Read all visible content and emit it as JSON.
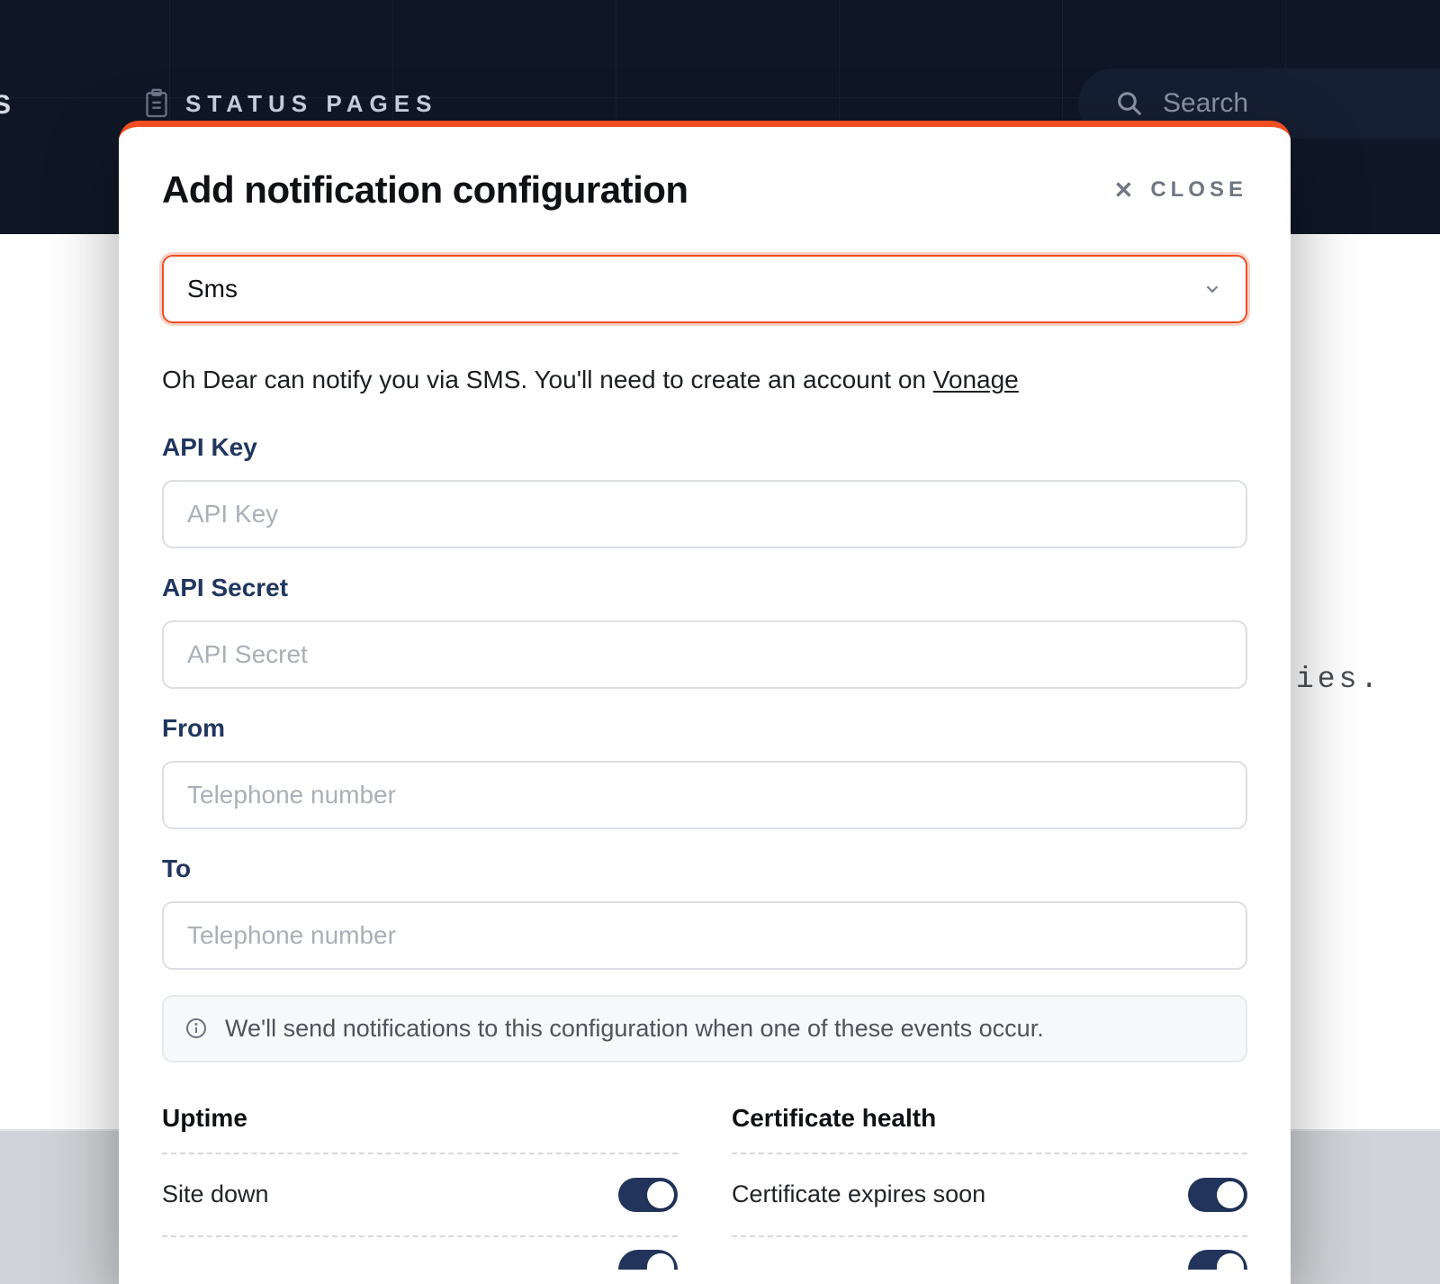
{
  "nav": {
    "crumb_label": "STATUS PAGES",
    "left_fragment": "S",
    "search_placeholder": "Search"
  },
  "bg_peek": "ies.",
  "modal": {
    "title": "Add notification configuration",
    "close_label": "CLOSE",
    "select_value": "Sms",
    "description_prefix": "Oh Dear can notify you via SMS. You'll need to create an account on ",
    "description_link_text": "Vonage",
    "fields": {
      "api_key": {
        "label": "API Key",
        "placeholder": "API Key"
      },
      "api_secret": {
        "label": "API Secret",
        "placeholder": "API Secret"
      },
      "from": {
        "label": "From",
        "placeholder": "Telephone number"
      },
      "to": {
        "label": "To",
        "placeholder": "Telephone number"
      }
    },
    "info_text": "We'll send notifications to this configuration when one of these events occur.",
    "toggle_sections": {
      "uptime": {
        "title": "Uptime",
        "row1": "Site down"
      },
      "cert": {
        "title": "Certificate health",
        "row1": "Certificate expires soon"
      }
    }
  }
}
